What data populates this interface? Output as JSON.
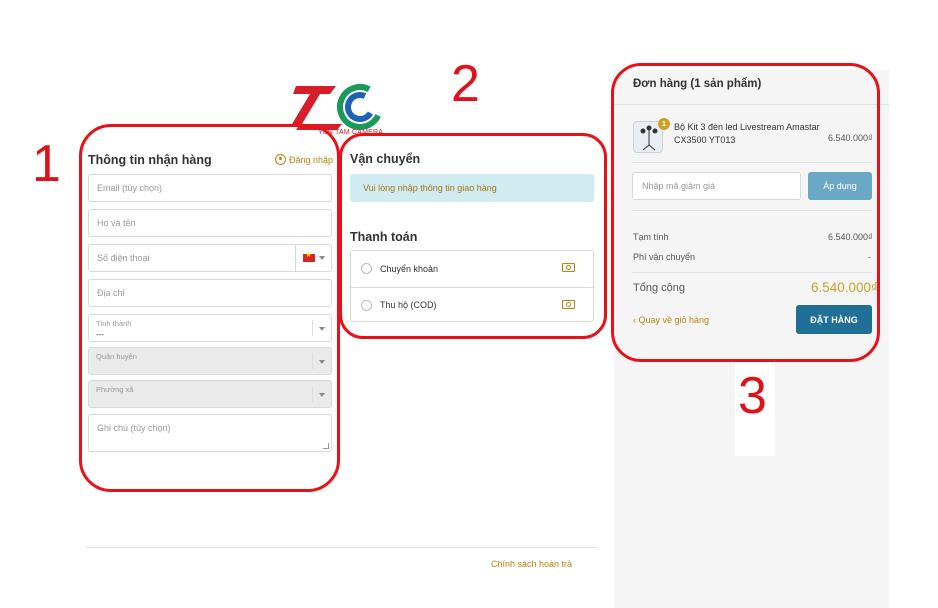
{
  "logo": {
    "text": "YEN TAM CAMERA"
  },
  "annotations": {
    "n1": "1",
    "n2": "2",
    "n3": "3"
  },
  "shipping_info": {
    "title": "Thông tin nhận hàng",
    "login_label": "Đăng nhập",
    "email_placeholder": "Email (tùy chọn)",
    "name_placeholder": "Họ và tên",
    "phone_placeholder": "Số điện thoại",
    "address_placeholder": "Địa chỉ",
    "province_label": "Tỉnh thành",
    "province_value": "---",
    "district_label": "Quận huyện",
    "ward_label": "Phường xã",
    "note_placeholder": "Ghi chú (tùy chọn)"
  },
  "shipping": {
    "title": "Vận chuyển",
    "notice": "Vui lòng nhập thông tin giao hàng"
  },
  "payment": {
    "title": "Thanh toán",
    "options": [
      {
        "label": "Chuyển khoản",
        "icon": "cash-icon"
      },
      {
        "label": "Thu hộ (COD)",
        "icon": "cash-icon"
      }
    ]
  },
  "order": {
    "title": "Đơn hàng (1 sản phẩm)",
    "product": {
      "qty": "1",
      "name": "Bộ Kit 3 đèn led Livestream Amastar CX3500 YT013",
      "price": "6.540.000₫"
    },
    "discount_placeholder": "Nhập mã giảm giá",
    "apply_label": "Áp dụng",
    "subtotal_label": "Tạm tính",
    "subtotal_value": "6.540.000₫",
    "shipping_fee_label": "Phí vận chuyển",
    "shipping_fee_value": "-",
    "total_label": "Tổng cộng",
    "total_value": "6.540.000₫",
    "back_label": "‹ Quay về giỏ hàng",
    "order_button": "ĐẶT HÀNG"
  },
  "footer": {
    "return_policy": "Chính sách hoàn trả"
  },
  "colors": {
    "accent": "#c9a227",
    "primary_button": "#1f6f97",
    "annotation": "#e8111a"
  }
}
